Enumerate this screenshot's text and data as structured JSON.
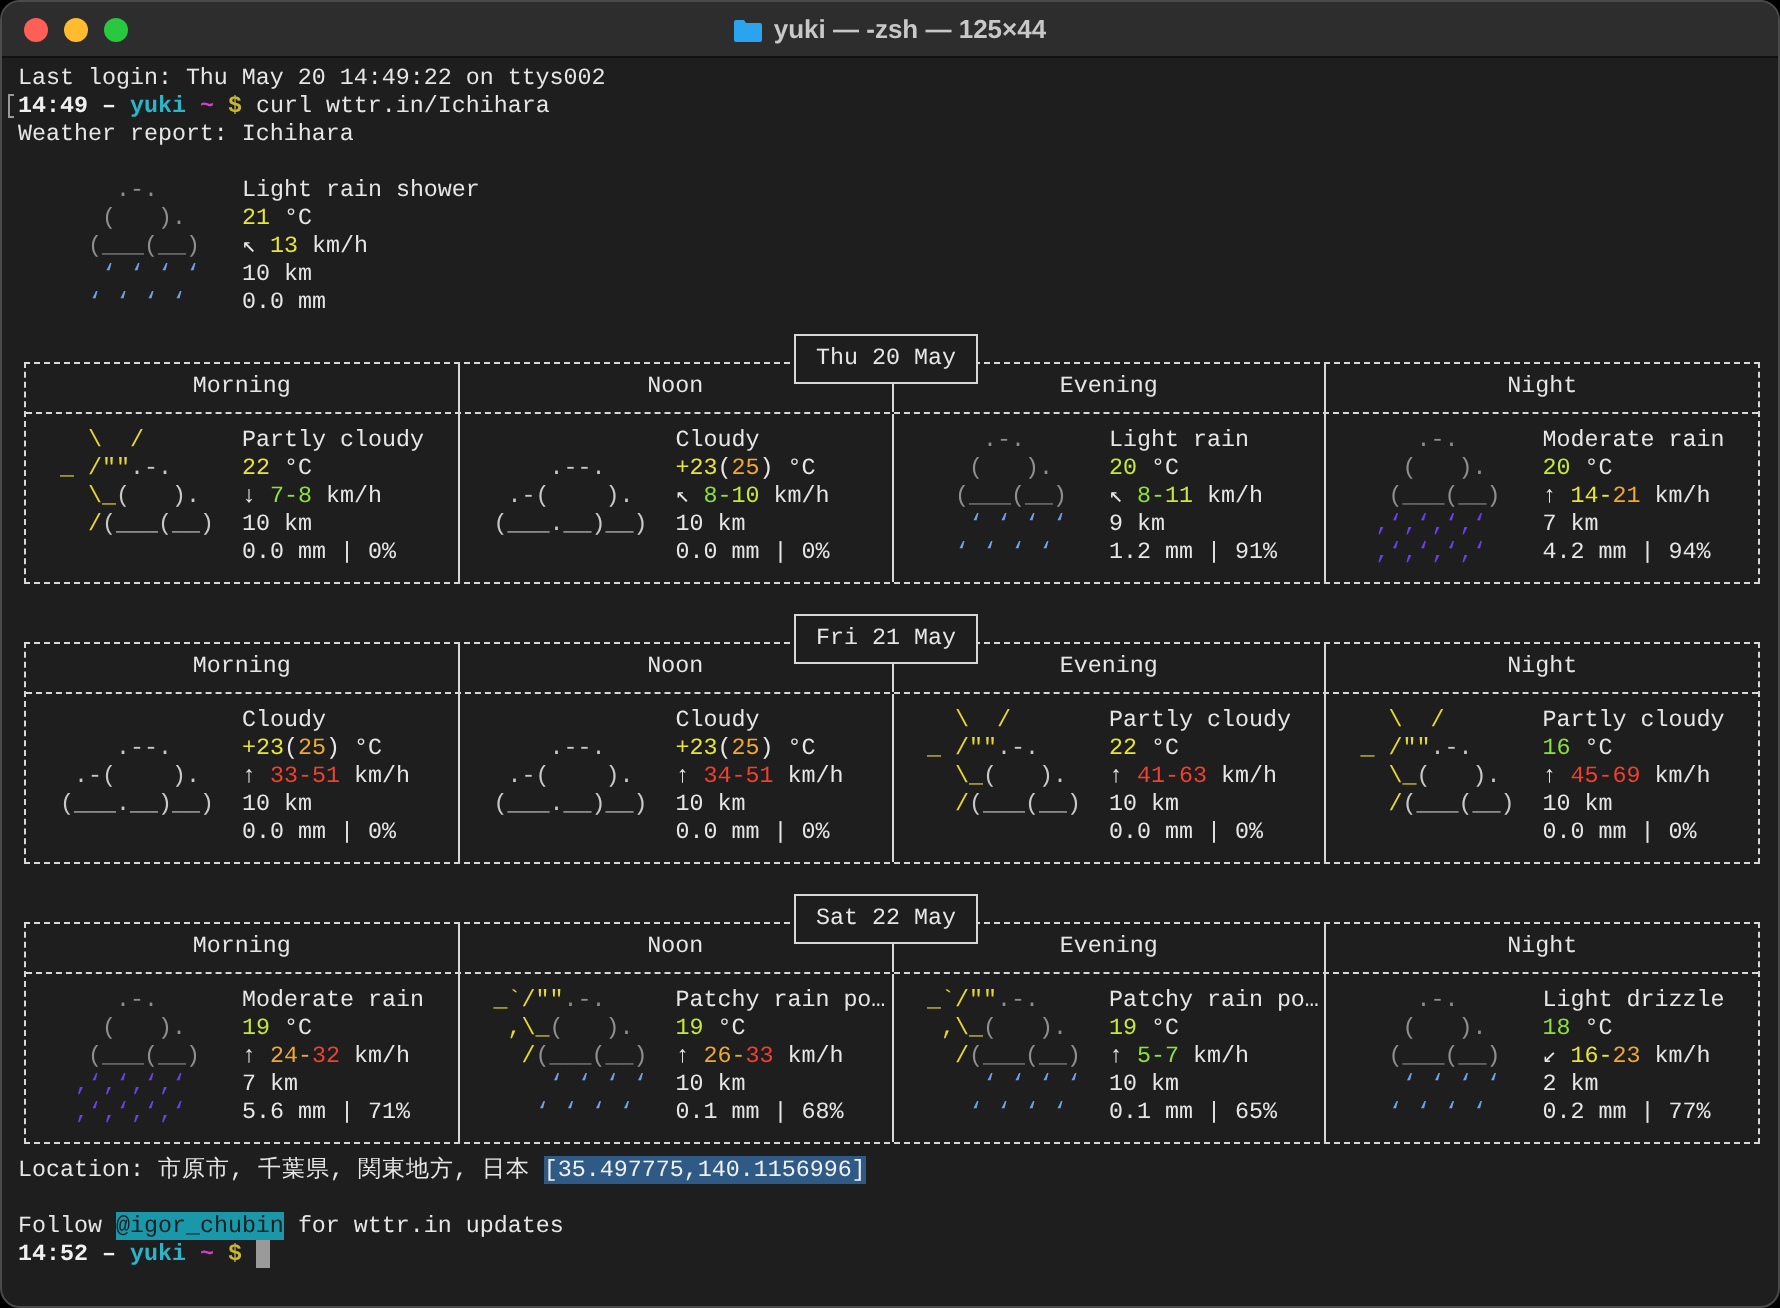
{
  "window": {
    "title": "yuki — -zsh — 125×44"
  },
  "terminal": {
    "login_line": "Last login: Thu May 20 14:49:22 on ttys002",
    "prompt": {
      "time": "14:49",
      "dash": "–",
      "user": "yuki",
      "dir": "~",
      "symbol": "$",
      "command": "curl wttr.in/Ichihara",
      "marked": true
    },
    "report_title": "Weather report: Ichihara",
    "current": {
      "art": {
        "kind": "rain",
        "lines": [
          [
            {
              "text": "       .-.",
              "color": "#8e8e8e"
            }
          ],
          [
            {
              "text": "      (   ).",
              "color": "#8e8e8e"
            }
          ],
          [
            {
              "text": "     (___(__)",
              "color": "#8e8e8e"
            }
          ],
          [
            {
              "text": "      ‘ ‘ ‘ ‘",
              "color": "#6ea2e8"
            }
          ],
          [
            {
              "text": "     ‘ ‘ ‘ ‘",
              "color": "#6ea2e8"
            }
          ]
        ]
      },
      "info": [
        [
          {
            "text": "Light rain shower"
          }
        ],
        [
          {
            "text": "21",
            "color": "#e6e635"
          },
          {
            "text": " °C"
          }
        ],
        [
          {
            "text": "↖ "
          },
          {
            "text": "13",
            "color": "#e6e635"
          },
          {
            "text": " km/h"
          }
        ],
        [
          {
            "text": "10 km"
          }
        ],
        [
          {
            "text": "0.0 mm"
          }
        ]
      ]
    },
    "days": [
      {
        "date": "Thu 20 May",
        "periods": [
          {
            "name": "Morning",
            "art": {
              "kind": "partly_cloudy",
              "lines": [
                [
                  {
                    "text": "    \\  /",
                    "color": "#e6d830"
                  }
                ],
                [
                  {
                    "text": "  _ /\"\"",
                    "color": "#e6d830"
                  },
                  {
                    "text": ".-.",
                    "color": "#c8c8c8"
                  }
                ],
                [
                  {
                    "text": "    \\_",
                    "color": "#e6d830"
                  },
                  {
                    "text": "(   ).",
                    "color": "#c8c8c8"
                  }
                ],
                [
                  {
                    "text": "    /",
                    "color": "#e6d830"
                  },
                  {
                    "text": "(___(__)",
                    "color": "#c8c8c8"
                  }
                ]
              ]
            },
            "info": [
              [
                {
                  "text": "Partly cloudy"
                }
              ],
              [
                {
                  "text": "22",
                  "color": "#e6e635"
                },
                {
                  "text": " °C"
                }
              ],
              [
                {
                  "text": "↓ "
                },
                {
                  "text": "7-",
                  "color": "#8ee03a"
                },
                {
                  "text": "8",
                  "color": "#8ee03a"
                },
                {
                  "text": " km/h"
                }
              ],
              [
                {
                  "text": "10 km"
                }
              ],
              [
                {
                  "text": "0.0 mm | 0%"
                }
              ]
            ]
          },
          {
            "name": "Noon",
            "art": {
              "kind": "cloudy",
              "lines": [
                [
                  {
                    "text": "      .--.",
                    "color": "#c8c8c8"
                  }
                ],
                [
                  {
                    "text": "   .-(    ).",
                    "color": "#c8c8c8"
                  }
                ],
                [
                  {
                    "text": "  (___.__)__)",
                    "color": "#c8c8c8"
                  }
                ]
              ]
            },
            "info": [
              [
                {
                  "text": "Cloudy"
                }
              ],
              [
                {
                  "text": "+23",
                  "color": "#e6e635"
                },
                {
                  "text": "("
                },
                {
                  "text": "25",
                  "color": "#f0a830"
                },
                {
                  "text": ") °C"
                }
              ],
              [
                {
                  "text": "↖ "
                },
                {
                  "text": "8-",
                  "color": "#8ee03a"
                },
                {
                  "text": "10",
                  "color": "#c6e83a"
                },
                {
                  "text": " km/h"
                }
              ],
              [
                {
                  "text": "10 km"
                }
              ],
              [
                {
                  "text": "0.0 mm | 0%"
                }
              ]
            ]
          },
          {
            "name": "Evening",
            "art": {
              "kind": "rain",
              "lines": [
                [
                  {
                    "text": "      .-.",
                    "color": "#8e8e8e"
                  }
                ],
                [
                  {
                    "text": "     (   ).",
                    "color": "#8e8e8e"
                  }
                ],
                [
                  {
                    "text": "    (___(__)",
                    "color": "#8e8e8e"
                  }
                ],
                [
                  {
                    "text": "     ‘ ‘ ‘ ‘",
                    "color": "#6ea2e8"
                  }
                ],
                [
                  {
                    "text": "    ‘ ‘ ‘ ‘",
                    "color": "#6ea2e8"
                  }
                ]
              ]
            },
            "info": [
              [
                {
                  "text": "Light rain"
                }
              ],
              [
                {
                  "text": "20",
                  "color": "#c6e83a"
                },
                {
                  "text": " °C"
                }
              ],
              [
                {
                  "text": "↖ "
                },
                {
                  "text": "8-",
                  "color": "#8ee03a"
                },
                {
                  "text": "11",
                  "color": "#c6e83a"
                },
                {
                  "text": " km/h"
                }
              ],
              [
                {
                  "text": "9 km"
                }
              ],
              [
                {
                  "text": "1.2 mm | 91%"
                }
              ]
            ]
          },
          {
            "name": "Night",
            "art": {
              "kind": "rain",
              "lines": [
                [
                  {
                    "text": "      .-.",
                    "color": "#8e8e8e"
                  }
                ],
                [
                  {
                    "text": "     (   ).",
                    "color": "#8e8e8e"
                  }
                ],
                [
                  {
                    "text": "    (___(__)",
                    "color": "#8e8e8e"
                  }
                ],
                [
                  {
                    "text": "   ‚‘‚‘‚‘‚‘",
                    "color": "#6a40f0"
                  }
                ],
                [
                  {
                    "text": "   ‚‘‚‘‚‘‚‘",
                    "color": "#6a40f0"
                  }
                ]
              ]
            },
            "info": [
              [
                {
                  "text": "Moderate rain"
                }
              ],
              [
                {
                  "text": "20",
                  "color": "#c6e83a"
                },
                {
                  "text": " °C"
                }
              ],
              [
                {
                  "text": "↑ "
                },
                {
                  "text": "14-",
                  "color": "#e6e635"
                },
                {
                  "text": "21",
                  "color": "#f0a830"
                },
                {
                  "text": " km/h"
                }
              ],
              [
                {
                  "text": "7 km"
                }
              ],
              [
                {
                  "text": "4.2 mm | 94%"
                }
              ]
            ]
          }
        ]
      },
      {
        "date": "Fri 21 May",
        "periods": [
          {
            "name": "Morning",
            "art": {
              "kind": "cloudy",
              "lines": [
                [
                  {
                    "text": "      .--.",
                    "color": "#c8c8c8"
                  }
                ],
                [
                  {
                    "text": "   .-(    ).",
                    "color": "#c8c8c8"
                  }
                ],
                [
                  {
                    "text": "  (___.__)__)",
                    "color": "#c8c8c8"
                  }
                ]
              ]
            },
            "info": [
              [
                {
                  "text": "Cloudy"
                }
              ],
              [
                {
                  "text": "+23",
                  "color": "#e6e635"
                },
                {
                  "text": "("
                },
                {
                  "text": "25",
                  "color": "#f0a830"
                },
                {
                  "text": ") °C"
                }
              ],
              [
                {
                  "text": "↑ "
                },
                {
                  "text": "33-51",
                  "color": "#f0402e"
                },
                {
                  "text": " km/h"
                }
              ],
              [
                {
                  "text": "10 km"
                }
              ],
              [
                {
                  "text": "0.0 mm | 0%"
                }
              ]
            ]
          },
          {
            "name": "Noon",
            "art": {
              "kind": "cloudy",
              "lines": [
                [
                  {
                    "text": "      .--.",
                    "color": "#c8c8c8"
                  }
                ],
                [
                  {
                    "text": "   .-(    ).",
                    "color": "#c8c8c8"
                  }
                ],
                [
                  {
                    "text": "  (___.__)__)",
                    "color": "#c8c8c8"
                  }
                ]
              ]
            },
            "info": [
              [
                {
                  "text": "Cloudy"
                }
              ],
              [
                {
                  "text": "+23",
                  "color": "#e6e635"
                },
                {
                  "text": "("
                },
                {
                  "text": "25",
                  "color": "#f0a830"
                },
                {
                  "text": ") °C"
                }
              ],
              [
                {
                  "text": "↑ "
                },
                {
                  "text": "34-51",
                  "color": "#f0402e"
                },
                {
                  "text": " km/h"
                }
              ],
              [
                {
                  "text": "10 km"
                }
              ],
              [
                {
                  "text": "0.0 mm | 0%"
                }
              ]
            ]
          },
          {
            "name": "Evening",
            "art": {
              "kind": "partly_cloudy",
              "lines": [
                [
                  {
                    "text": "    \\  /",
                    "color": "#e6d830"
                  }
                ],
                [
                  {
                    "text": "  _ /\"\"",
                    "color": "#e6d830"
                  },
                  {
                    "text": ".-.",
                    "color": "#c8c8c8"
                  }
                ],
                [
                  {
                    "text": "    \\_",
                    "color": "#e6d830"
                  },
                  {
                    "text": "(   ).",
                    "color": "#c8c8c8"
                  }
                ],
                [
                  {
                    "text": "    /",
                    "color": "#e6d830"
                  },
                  {
                    "text": "(___(__)",
                    "color": "#c8c8c8"
                  }
                ]
              ]
            },
            "info": [
              [
                {
                  "text": "Partly cloudy"
                }
              ],
              [
                {
                  "text": "22",
                  "color": "#e6e635"
                },
                {
                  "text": " °C"
                }
              ],
              [
                {
                  "text": "↑ "
                },
                {
                  "text": "41-63",
                  "color": "#f0402e"
                },
                {
                  "text": " km/h"
                }
              ],
              [
                {
                  "text": "10 km"
                }
              ],
              [
                {
                  "text": "0.0 mm | 0%"
                }
              ]
            ]
          },
          {
            "name": "Night",
            "art": {
              "kind": "partly_cloudy",
              "lines": [
                [
                  {
                    "text": "    \\  /",
                    "color": "#e6d830"
                  }
                ],
                [
                  {
                    "text": "  _ /\"\"",
                    "color": "#e6d830"
                  },
                  {
                    "text": ".-.",
                    "color": "#c8c8c8"
                  }
                ],
                [
                  {
                    "text": "    \\_",
                    "color": "#e6d830"
                  },
                  {
                    "text": "(   ).",
                    "color": "#c8c8c8"
                  }
                ],
                [
                  {
                    "text": "    /",
                    "color": "#e6d830"
                  },
                  {
                    "text": "(___(__)",
                    "color": "#c8c8c8"
                  }
                ]
              ]
            },
            "info": [
              [
                {
                  "text": "Partly cloudy"
                }
              ],
              [
                {
                  "text": "16",
                  "color": "#8ee03a"
                },
                {
                  "text": " °C"
                }
              ],
              [
                {
                  "text": "↑ "
                },
                {
                  "text": "45-69",
                  "color": "#f0402e"
                },
                {
                  "text": " km/h"
                }
              ],
              [
                {
                  "text": "10 km"
                }
              ],
              [
                {
                  "text": "0.0 mm | 0%"
                }
              ]
            ]
          }
        ]
      },
      {
        "date": "Sat 22 May",
        "periods": [
          {
            "name": "Morning",
            "art": {
              "kind": "rain",
              "lines": [
                [
                  {
                    "text": "      .-.",
                    "color": "#8e8e8e"
                  }
                ],
                [
                  {
                    "text": "     (   ).",
                    "color": "#8e8e8e"
                  }
                ],
                [
                  {
                    "text": "    (___(__)",
                    "color": "#8e8e8e"
                  }
                ],
                [
                  {
                    "text": "   ‚‘‚‘‚‘‚‘",
                    "color": "#6a40f0"
                  }
                ],
                [
                  {
                    "text": "   ‚‘‚‘‚‘‚‘",
                    "color": "#6a40f0"
                  }
                ]
              ]
            },
            "info": [
              [
                {
                  "text": "Moderate rain"
                }
              ],
              [
                {
                  "text": "19",
                  "color": "#c6e83a"
                },
                {
                  "text": " °C"
                }
              ],
              [
                {
                  "text": "↑ "
                },
                {
                  "text": "24-",
                  "color": "#f0a830"
                },
                {
                  "text": "32",
                  "color": "#f0402e"
                },
                {
                  "text": " km/h"
                }
              ],
              [
                {
                  "text": "7 km"
                }
              ],
              [
                {
                  "text": "5.6 mm | 71%"
                }
              ]
            ]
          },
          {
            "name": "Noon",
            "art": {
              "kind": "patchy_rain",
              "lines": [
                [
                  {
                    "text": "  _`/\"\"",
                    "color": "#e6d830"
                  },
                  {
                    "text": ".-.",
                    "color": "#8e8e8e"
                  }
                ],
                [
                  {
                    "text": "   ,\\_",
                    "color": "#e6d830"
                  },
                  {
                    "text": "(   ).",
                    "color": "#8e8e8e"
                  }
                ],
                [
                  {
                    "text": "    /",
                    "color": "#e6d830"
                  },
                  {
                    "text": "(___(__)",
                    "color": "#8e8e8e"
                  }
                ],
                [
                  {
                    "text": "      ‘ ‘ ‘ ‘",
                    "color": "#6ea2e8"
                  }
                ],
                [
                  {
                    "text": "     ‘ ‘ ‘ ‘",
                    "color": "#6ea2e8"
                  }
                ]
              ]
            },
            "info": [
              [
                {
                  "text": "Patchy rain po…"
                }
              ],
              [
                {
                  "text": "19",
                  "color": "#c6e83a"
                },
                {
                  "text": " °C"
                }
              ],
              [
                {
                  "text": "↑ "
                },
                {
                  "text": "26-",
                  "color": "#f0a830"
                },
                {
                  "text": "33",
                  "color": "#f0402e"
                },
                {
                  "text": " km/h"
                }
              ],
              [
                {
                  "text": "10 km"
                }
              ],
              [
                {
                  "text": "0.1 mm | 68%"
                }
              ]
            ]
          },
          {
            "name": "Evening",
            "art": {
              "kind": "patchy_rain",
              "lines": [
                [
                  {
                    "text": "  _`/\"\"",
                    "color": "#e6d830"
                  },
                  {
                    "text": ".-.",
                    "color": "#8e8e8e"
                  }
                ],
                [
                  {
                    "text": "   ,\\_",
                    "color": "#e6d830"
                  },
                  {
                    "text": "(   ).",
                    "color": "#8e8e8e"
                  }
                ],
                [
                  {
                    "text": "    /",
                    "color": "#e6d830"
                  },
                  {
                    "text": "(___(__)",
                    "color": "#8e8e8e"
                  }
                ],
                [
                  {
                    "text": "      ‘ ‘ ‘ ‘",
                    "color": "#6ea2e8"
                  }
                ],
                [
                  {
                    "text": "     ‘ ‘ ‘ ‘",
                    "color": "#6ea2e8"
                  }
                ]
              ]
            },
            "info": [
              [
                {
                  "text": "Patchy rain po…"
                }
              ],
              [
                {
                  "text": "19",
                  "color": "#c6e83a"
                },
                {
                  "text": " °C"
                }
              ],
              [
                {
                  "text": "↑ "
                },
                {
                  "text": "5-7",
                  "color": "#8ee03a"
                },
                {
                  "text": " km/h"
                }
              ],
              [
                {
                  "text": "10 km"
                }
              ],
              [
                {
                  "text": "0.1 mm | 65%"
                }
              ]
            ]
          },
          {
            "name": "Night",
            "art": {
              "kind": "rain",
              "lines": [
                [
                  {
                    "text": "      .-.",
                    "color": "#8e8e8e"
                  }
                ],
                [
                  {
                    "text": "     (   ).",
                    "color": "#8e8e8e"
                  }
                ],
                [
                  {
                    "text": "    (___(__)",
                    "color": "#8e8e8e"
                  }
                ],
                [
                  {
                    "text": "     ‘ ‘ ‘ ‘",
                    "color": "#6ea2e8"
                  }
                ],
                [
                  {
                    "text": "    ‘ ‘ ‘ ‘",
                    "color": "#6ea2e8"
                  }
                ]
              ]
            },
            "info": [
              [
                {
                  "text": "Light drizzle"
                }
              ],
              [
                {
                  "text": "18",
                  "color": "#8ee03a"
                },
                {
                  "text": " °C"
                }
              ],
              [
                {
                  "text": "↙ "
                },
                {
                  "text": "16-",
                  "color": "#e6e635"
                },
                {
                  "text": "23",
                  "color": "#f0a830"
                },
                {
                  "text": " km/h"
                }
              ],
              [
                {
                  "text": "2 km"
                }
              ],
              [
                {
                  "text": "0.2 mm | 77%"
                }
              ]
            ]
          }
        ]
      }
    ],
    "location": {
      "label": "Location: 市原市, 千葉県, 関東地方, 日本",
      "coordinates": "[35.497775,140.1156996]"
    },
    "follow": {
      "before": "Follow",
      "handle": "@igor_chubin",
      "after": "for wttr.in updates"
    },
    "prompt2": {
      "time": "14:52",
      "dash": "–",
      "user": "yuki",
      "dir": "~",
      "symbol": "$",
      "marked": false
    }
  }
}
